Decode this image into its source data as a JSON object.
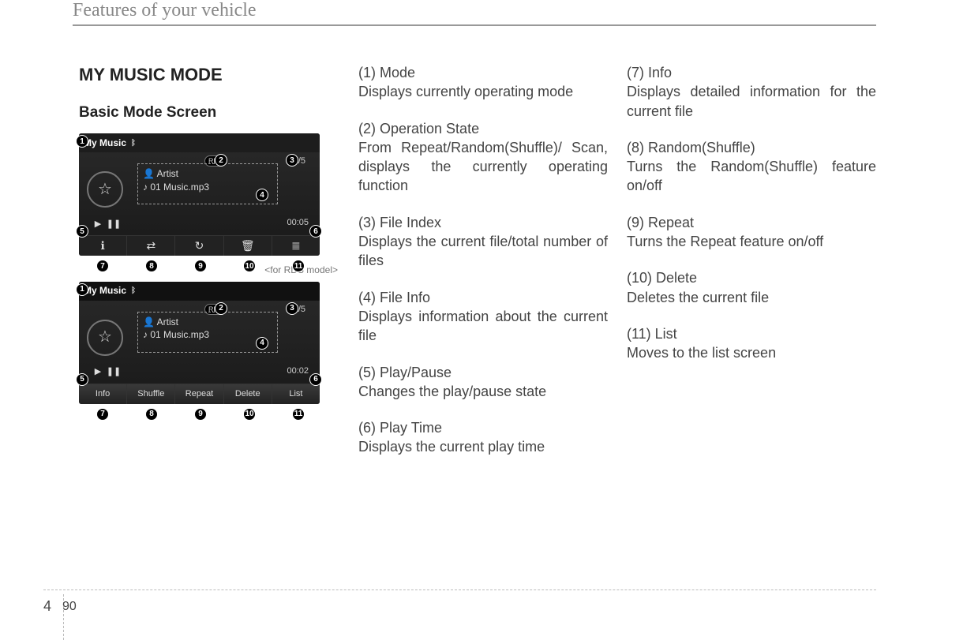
{
  "header": {
    "title": "Features of your vehicle"
  },
  "footer": {
    "chapter": "4",
    "page": "90"
  },
  "col1": {
    "h1": "MY MUSIC MODE",
    "h2": "Basic Mode Screen",
    "caption_rds": "<for RDS model>"
  },
  "screenshots": {
    "common": {
      "mode_label": "My Music",
      "artist_label": "Artist",
      "track_label": "01 Music.mp3",
      "file_index": "1/5",
      "rpt_pill": "RPT"
    },
    "top": {
      "play_time": "00:05",
      "buttons_icons": [
        "ℹ",
        "⇄",
        "↻",
        "🗑",
        "≣"
      ]
    },
    "rds": {
      "play_time": "00:02",
      "buttons_text": [
        "Info",
        "Shuffle",
        "Repeat",
        "Delete",
        "List"
      ]
    },
    "badge_labels": [
      "1",
      "2",
      "3",
      "4",
      "5",
      "6",
      "7",
      "8",
      "9",
      "10",
      "11"
    ]
  },
  "descriptions": [
    {
      "num": "(1) Mode",
      "text": "Displays currently operating mode"
    },
    {
      "num": "(2) Operation State",
      "text": "From Repeat/Random(Shuffle)/ Scan, displays the currently operating function"
    },
    {
      "num": "(3) File Index",
      "text": "Displays the current file/total number of files"
    },
    {
      "num": "(4) File Info",
      "text": "Displays information about the current file"
    },
    {
      "num": "(5) Play/Pause",
      "text": "Changes the play/pause state"
    },
    {
      "num": "(6) Play Time",
      "text": "Displays the current play time"
    },
    {
      "num": "(7) Info",
      "text": "Displays detailed information for the current file"
    },
    {
      "num": "(8) Random(Shuffle)",
      "text": "Turns the Random(Shuffle) feature on/off"
    },
    {
      "num": "(9) Repeat",
      "text": "Turns the Repeat feature on/off"
    },
    {
      "num": "(10) Delete",
      "text": "Deletes the current file"
    },
    {
      "num": "(11) List",
      "text": "Moves to the list screen"
    }
  ]
}
